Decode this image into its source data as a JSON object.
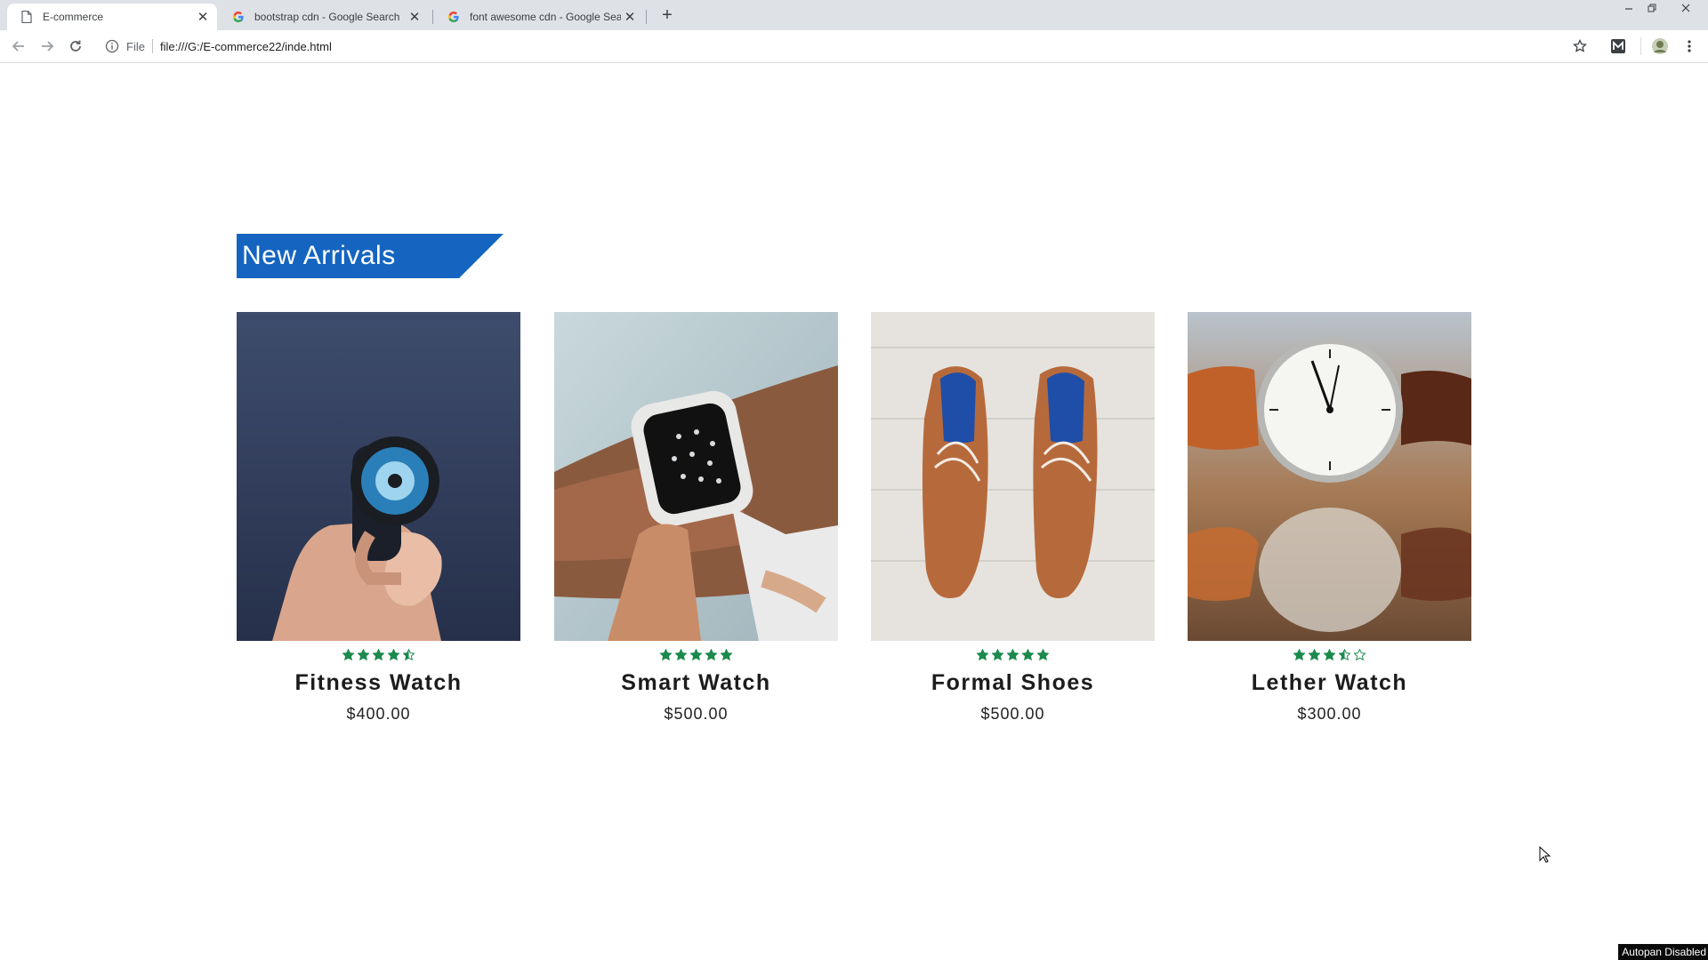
{
  "browser": {
    "tabs": [
      {
        "title": "E-commerce",
        "active": true,
        "icon": "document-icon"
      },
      {
        "title": "bootstrap cdn - Google Search",
        "active": false,
        "icon": "google-icon"
      },
      {
        "title": "font awesome cdn - Google Sear",
        "active": false,
        "icon": "google-icon"
      }
    ],
    "new_tab_label": "+",
    "close_glyph": "✕",
    "address": {
      "scheme_label": "File",
      "url": "file:///G:/E-commerce22/inde.html"
    }
  },
  "section": {
    "title": "New Arrivals",
    "accent_color": "#1565c0"
  },
  "products": [
    {
      "name": "Fitness Watch",
      "price": "$400.00",
      "rating": 4.5,
      "image": "fitness-watch-photo"
    },
    {
      "name": "Smart Watch",
      "price": "$500.00",
      "rating": 5,
      "image": "smart-watch-photo"
    },
    {
      "name": "Formal Shoes",
      "price": "$500.00",
      "rating": 5,
      "image": "formal-shoes-photo"
    },
    {
      "name": "Lether Watch",
      "price": "$300.00",
      "rating": 3.5,
      "image": "leather-watch-photo"
    }
  ],
  "star_color": "#1b8a4c",
  "status_text": "Autopan Disabled"
}
